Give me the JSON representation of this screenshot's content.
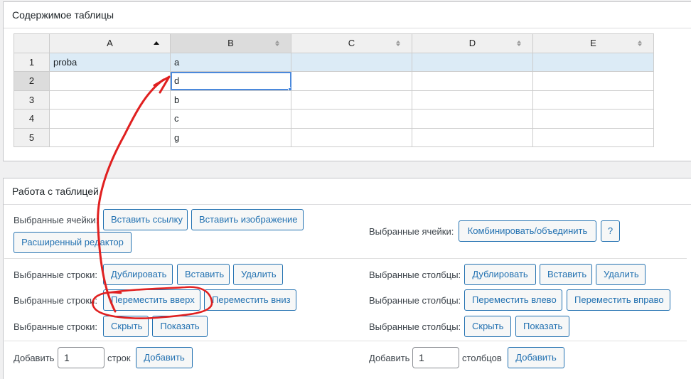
{
  "panels": {
    "table_content_title": "Содержимое таблицы",
    "table_work_title": "Работа с таблицей"
  },
  "grid": {
    "columns": [
      "A",
      "B",
      "C",
      "D",
      "E"
    ],
    "rows": [
      {
        "num": "1",
        "cells": [
          "proba",
          "a",
          "",
          "",
          ""
        ]
      },
      {
        "num": "2",
        "cells": [
          "",
          "d",
          "",
          "",
          ""
        ]
      },
      {
        "num": "3",
        "cells": [
          "",
          "b",
          "",
          "",
          ""
        ]
      },
      {
        "num": "4",
        "cells": [
          "",
          "c",
          "",
          "",
          ""
        ]
      },
      {
        "num": "5",
        "cells": [
          "",
          "g",
          "",
          "",
          ""
        ]
      }
    ]
  },
  "cells_ops": {
    "label": "Выбранные ячейки:",
    "insert_link": "Вставить ссылку",
    "insert_image": "Вставить изображение",
    "advanced_editor": "Расширенный редактор",
    "label_right": "Выбранные ячейки:",
    "merge": "Комбинировать/объединить",
    "help": "?"
  },
  "rows_ops": {
    "label": "Выбранные строки:",
    "duplicate": "Дублировать",
    "insert": "Вставить",
    "delete": "Удалить",
    "move_up": "Переместить вверх",
    "move_down": "Переместить вниз",
    "hide": "Скрыть",
    "show": "Показать"
  },
  "cols_ops": {
    "label": "Выбранные столбцы:",
    "duplicate": "Дублировать",
    "insert": "Вставить",
    "delete": "Удалить",
    "move_left": "Переместить влево",
    "move_right": "Переместить вправо",
    "hide": "Скрыть",
    "show": "Показать"
  },
  "add_rows": {
    "label": "Добавить",
    "value": "1",
    "unit": "строк",
    "button": "Добавить"
  },
  "add_cols": {
    "label": "Добавить",
    "value": "1",
    "unit": "столбцов",
    "button": "Добавить"
  },
  "colors": {
    "accent": "#2271b1",
    "selected_row": "#dcebf6",
    "annotation": "#e02020"
  }
}
